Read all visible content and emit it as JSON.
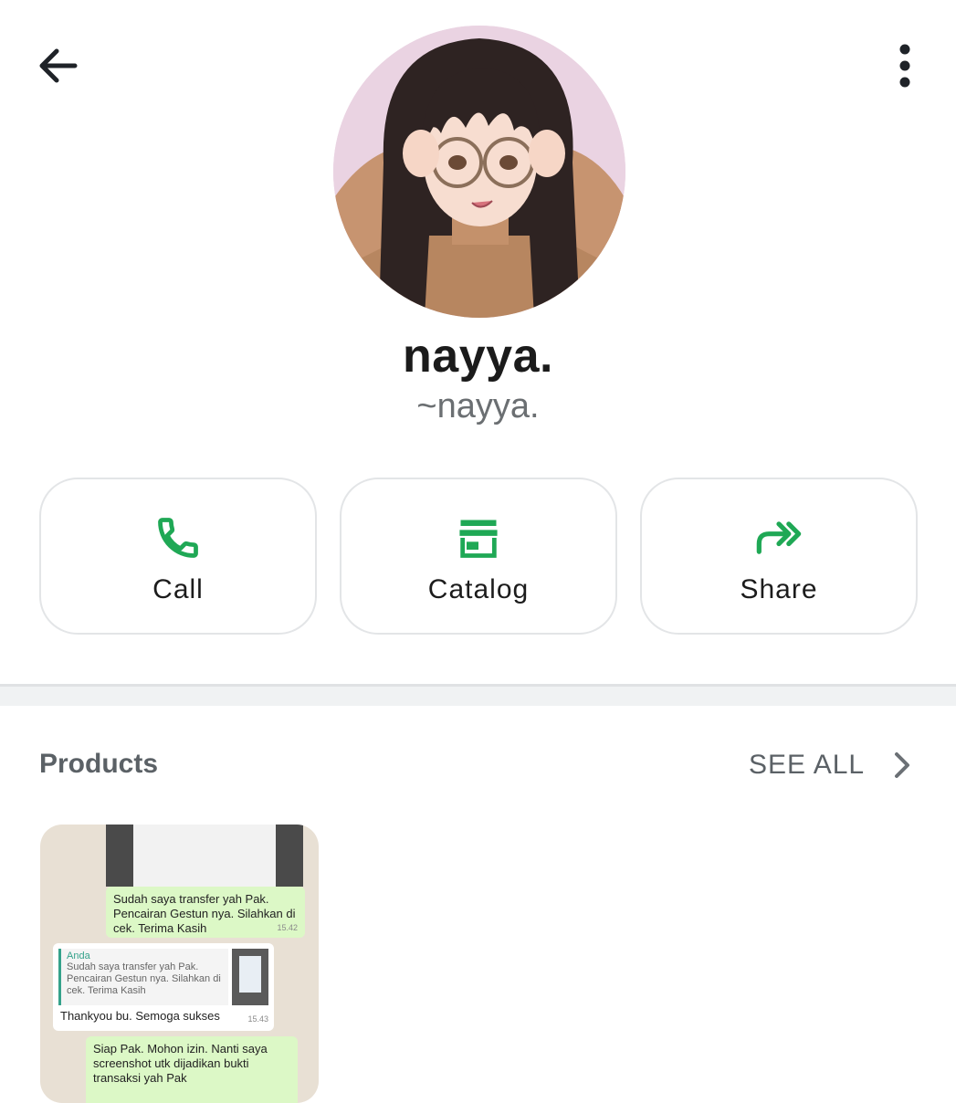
{
  "header": {
    "back_icon": "arrow-left-icon",
    "menu_icon": "more-vertical-icon"
  },
  "profile": {
    "name": "nayya.",
    "push_name": "~nayya."
  },
  "actions": [
    {
      "label": "Call",
      "icon": "phone-icon"
    },
    {
      "label": "Catalog",
      "icon": "storefront-icon"
    },
    {
      "label": "Share",
      "icon": "share-forward-icon"
    }
  ],
  "colors": {
    "accent": "#1fa855",
    "text_primary": "#1b1b1b",
    "text_secondary": "#5b6166"
  },
  "products": {
    "title": "Products",
    "see_all": "SEE ALL",
    "items": [
      {
        "bubble1": "Sudah saya transfer yah Pak. Pencairan Gestun nya. Silahkan di cek. Terima Kasih",
        "bubble1_time": "15.42",
        "quote_author": "Anda",
        "quote_text": "Sudah saya transfer yah Pak. Pencairan Gestun nya. Silahkan di cek. Terima Kasih",
        "reply": "Thankyou bu. Semoga sukses",
        "reply_time": "15.43",
        "bubble3": "Siap Pak. Mohon izin. Nanti saya screenshot utk dijadikan bukti transaksi yah Pak"
      }
    ]
  }
}
